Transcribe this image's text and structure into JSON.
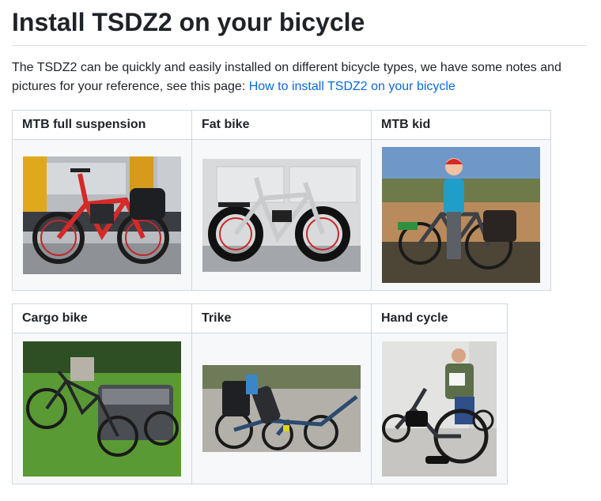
{
  "heading": "Install TSDZ2 on your bicycle",
  "intro": {
    "text": "The TSDZ2 can be quickly and easily installed on different bicycle types, we have some notes and pictures for your reference, see this page: ",
    "link_text": "How to install TSDZ2 on your bicycle"
  },
  "table1": {
    "headers": [
      "MTB full suspension",
      "Fat bike",
      "MTB kid"
    ],
    "photos": [
      "red-mtb-on-train-photo",
      "silver-fat-bike-photo",
      "kid-on-mtb-photo"
    ]
  },
  "table2": {
    "headers": [
      "Cargo bike",
      "Trike",
      "Hand cycle"
    ],
    "photos": [
      "cargo-bike-photo",
      "recumbent-trike-photo",
      "hand-cycle-photo"
    ]
  },
  "colors": {
    "link": "#0969da",
    "border": "#d0d7de",
    "cell_bg": "#f6f8fa"
  }
}
